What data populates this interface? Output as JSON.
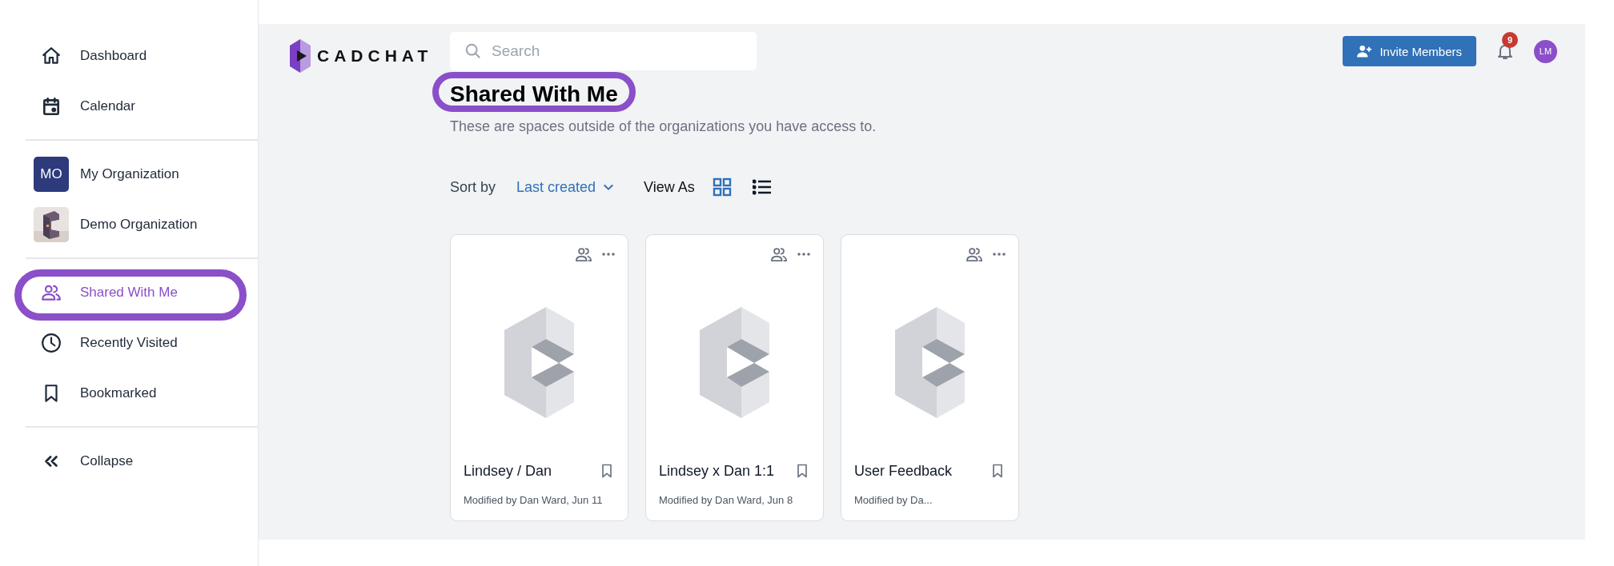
{
  "sidebar": {
    "items": [
      {
        "kind": "home",
        "label": "Dashboard",
        "selected": false,
        "highlighted": false
      },
      {
        "kind": "calendar",
        "label": "Calendar",
        "selected": false,
        "highlighted": false
      },
      {
        "kind": "divider"
      },
      {
        "kind": "org",
        "initials": "MO",
        "label": "My Organization",
        "selected": false,
        "highlighted": false
      },
      {
        "kind": "org-picture",
        "label": "Demo Organization",
        "selected": false,
        "highlighted": false
      },
      {
        "kind": "divider"
      },
      {
        "kind": "people",
        "label": "Shared With Me",
        "selected": true,
        "highlighted": true
      },
      {
        "kind": "clock",
        "label": "Recently Visited",
        "selected": false,
        "highlighted": false
      },
      {
        "kind": "bookmark",
        "label": "Bookmarked",
        "selected": false,
        "highlighted": false
      },
      {
        "kind": "divider"
      },
      {
        "kind": "collapse",
        "label": "Collapse",
        "selected": false,
        "highlighted": false
      }
    ]
  },
  "header": {
    "logo": "CADCHAT",
    "search": {
      "placeholder": "Search"
    },
    "invite_button": "Invite Members",
    "notifications": "9",
    "avatar": "LM"
  },
  "page": {
    "title": "Shared With Me",
    "title_highlighted": true,
    "subtitle": "These are spaces outside of the organizations you have access to."
  },
  "toolbar": {
    "sort_label": "Sort by",
    "sort_value": "Last created",
    "view_label": "View As",
    "views": [
      {
        "kind": "grid",
        "selected": true
      },
      {
        "kind": "list",
        "selected": false
      }
    ]
  },
  "cards": [
    {
      "title": "Lindsey / Dan",
      "modified": "Modified by Dan Ward, Jun 11"
    },
    {
      "title": "Lindsey x Dan 1:1",
      "modified": "Modified by Dan Ward, Jun 8"
    },
    {
      "title": "User Feedback",
      "modified": "Modified by Da..."
    }
  ]
}
